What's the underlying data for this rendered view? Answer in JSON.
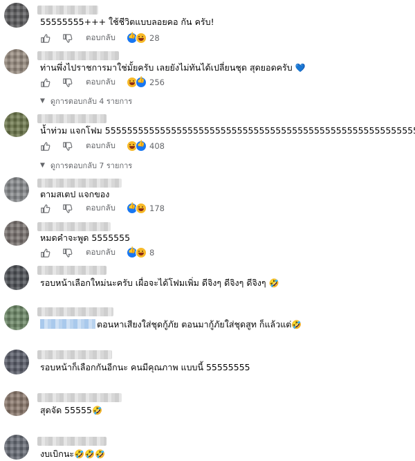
{
  "reply_label": "ตอบกลับ",
  "comments": [
    {
      "text": "55555555+++ ใช้ชีวิตแบบลอยคอ กัน ครับ!",
      "reaction_count": "28"
    },
    {
      "text": "ท่านพึ่งไปราชการมาใช่มั้ยครับ เลยยังไม่ทันได้เปลี่ยนชุด สุดยอดครับ",
      "heart": "💙",
      "reaction_count": "256",
      "view_replies": "ดูการตอบกลับ 4 รายการ"
    },
    {
      "text": "น้ำท่วม แจกโฟม 5555555555555555555555555555555555555555555555555555555555",
      "reaction_count": "408",
      "view_replies": "ดูการตอบกลับ 7 รายการ"
    },
    {
      "text": "ตามสเตป แจกของ",
      "reaction_count": "178"
    },
    {
      "text": "หมดคำจะพูด 5555555",
      "reaction_count": "8"
    },
    {
      "text": "รอบหน้าเลือกใหม่นะครับ เผื่อจะได้โฟมเพิ่ม ดีจิงๆ ดีจิงๆ ดีจิงๆ",
      "emoji": "🤣"
    },
    {
      "text": "ตอนหาเสียงใส่ชุดกู้ภัย ตอนมากู้ภัยใส่ชุดสูท ก็แล้วแต่",
      "emoji": "🤣"
    },
    {
      "text": "รอบหน้าก็เลือกกันอีกนะ คนมีคุณภาพ แบบนี้ 55555555"
    },
    {
      "text": "สุดจัด 55555",
      "emoji": "🤣"
    },
    {
      "text": "งบเบิกนะ",
      "emoji": "🤣🤣🤣"
    }
  ]
}
